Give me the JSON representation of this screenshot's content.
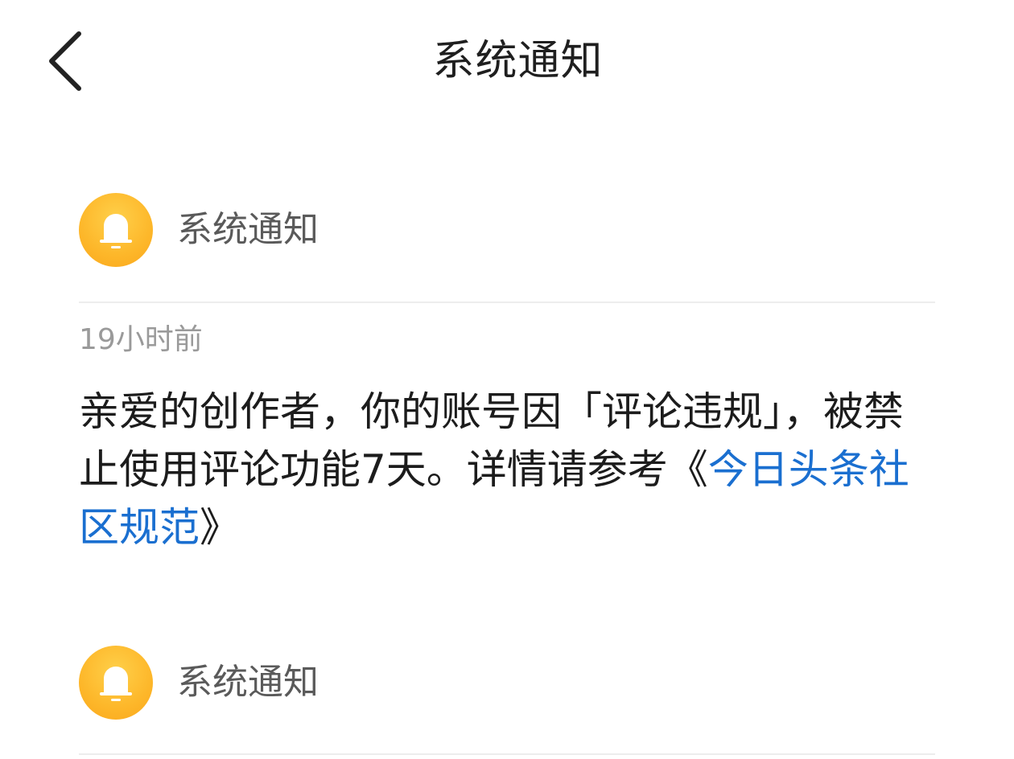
{
  "header": {
    "title": "系统通知",
    "back_icon": "chevron-left-icon"
  },
  "notifications": [
    {
      "source": "系统通知",
      "icon": "bell-icon",
      "time": "19小时前",
      "message_prefix": "亲爱的创作者，你的账号因「评论违规」，被禁止使用评论功能7天。详情请参考《",
      "link_text": "今日头条社区规范",
      "message_suffix": "》"
    },
    {
      "source": "系统通知",
      "icon": "bell-icon"
    }
  ],
  "colors": {
    "accent_link": "#1a6fd0",
    "avatar_yellow": "#fdb72a",
    "divider": "#ededed"
  }
}
